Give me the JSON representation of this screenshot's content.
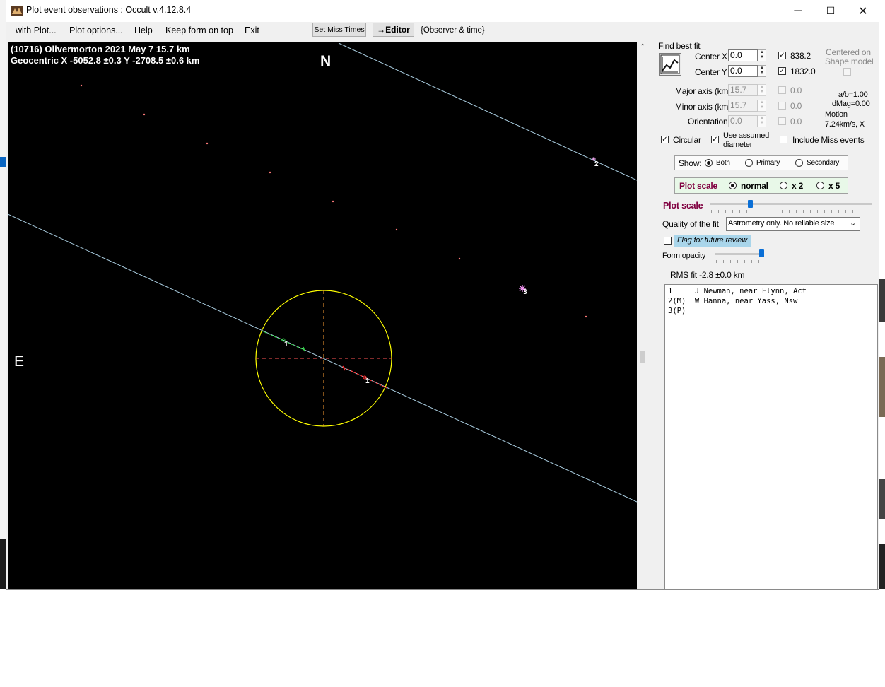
{
  "window": {
    "title": "Plot event observations : Occult v.4.12.8.4",
    "minimize": "─",
    "maximize": "☐",
    "close": "✕"
  },
  "menu": {
    "with_plot": "with Plot...",
    "plot_options": "Plot options...",
    "help": "Help",
    "keep_on_top": "Keep form on top",
    "exit": "Exit",
    "set_miss_times": "Set Miss Times",
    "editor": "→Editor",
    "observer_time": "{Observer & time}"
  },
  "plot": {
    "line1": "(10716) Olivermorton  2021 May 7  15.7 km",
    "line2": "Geocentric  X  -5052.8 ±0.3  Y -2708.5 ±0.6 km",
    "north": "N",
    "east": "E",
    "chord_label_green": "1",
    "chord_label_red": "1",
    "chord_label_2": "2",
    "chord_label_3": "3"
  },
  "panel": {
    "find_best_fit": "Find best fit",
    "center_x_label": "Center X",
    "center_x_value": "0.0",
    "center_y_label": "Center Y",
    "center_y_value": "0.0",
    "check_x_value": "838.2",
    "check_y_value": "1832.0",
    "centered_on_1": "Centered on",
    "centered_on_2": "Shape model",
    "major_axis_label": "Major axis (km)",
    "major_axis_value": "15.7",
    "minor_axis_label": "Minor axis (km)",
    "minor_axis_value": "15.7",
    "orientation_label": "Orientation",
    "orientation_value": "0.0",
    "dis_major": "0.0",
    "dis_minor": "0.0",
    "dis_orient": "0.0",
    "ab_ratio": "a/b=1.00",
    "dmag": "dMag=0.00",
    "motion_label": "Motion",
    "motion_value": "7.24km/s, X",
    "circular": "Circular",
    "use_assumed_1": "Use assumed",
    "use_assumed_2": "diameter",
    "include_miss": "Include Miss events",
    "show_label": "Show:",
    "show_both": "Both",
    "show_primary": "Primary",
    "show_secondary": "Secondary",
    "plot_scale_group": "Plot scale",
    "scale_normal": "normal",
    "scale_x2": "x 2",
    "scale_x5": "x 5",
    "plot_scale_slider_label": "Plot scale",
    "plot_scale_position": 0.24,
    "quality_label": "Quality of the fit",
    "quality_value": "Astrometry only. No reliable size",
    "flag_review": "Flag for future review",
    "form_opacity": "Form opacity",
    "form_opacity_position": 1.0,
    "rms_fit": "RMS fit -2.8 ±0.0 km",
    "observers": [
      "1     J Newman, near Flynn, Act",
      "2(M)  W Hanna, near Yass, Nsw",
      "3(P)"
    ]
  },
  "colors": {
    "plot_bg": "#000000",
    "limb": "#ffff00",
    "chord_line": "#a9cde0",
    "green_chord": "#2ecc40",
    "red_chord": "#ff2a2a",
    "dots": "#ff7a7a",
    "axes": "#ff9f33",
    "flag_bg": "#a9d5ea",
    "scale_group_bg": "#e8f8e8",
    "scale_label": "#800040"
  }
}
